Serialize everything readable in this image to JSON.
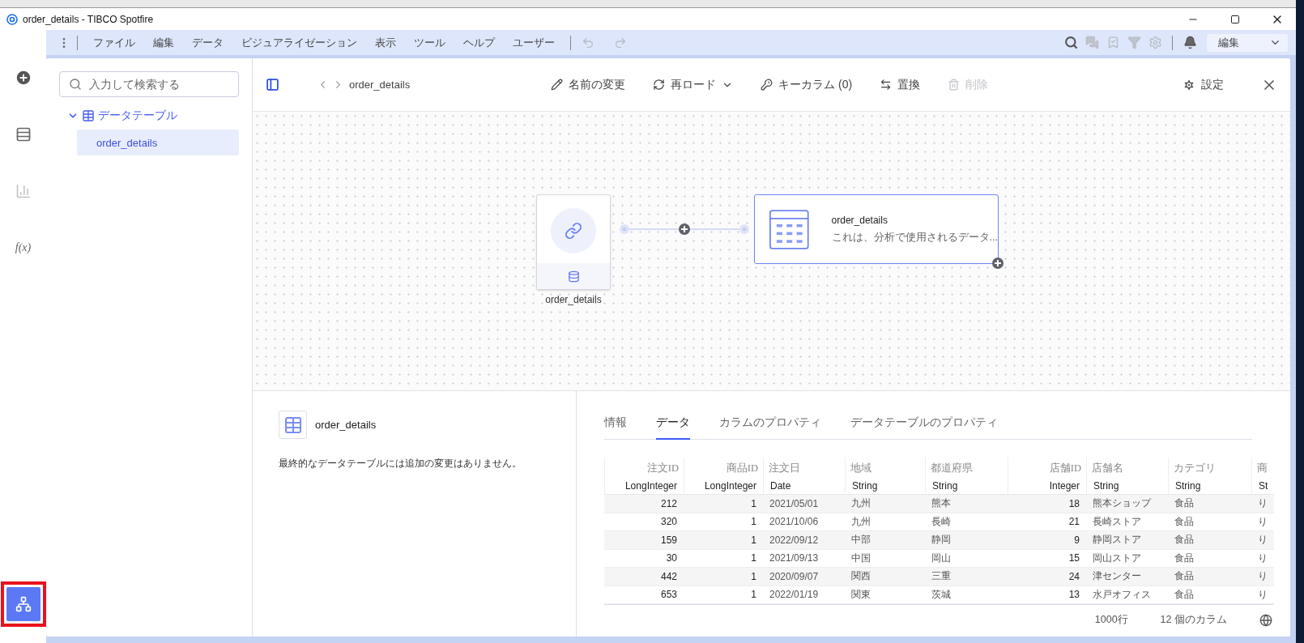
{
  "window": {
    "title": "order_details - TIBCO Spotfire"
  },
  "menu": [
    "ファイル",
    "編集",
    "データ",
    "ビジュアライゼーション",
    "表示",
    "ツール",
    "ヘルプ",
    "ユーザー"
  ],
  "mode_dropdown": {
    "value": "編集"
  },
  "rail": [
    {
      "kind": "add",
      "selected": false
    },
    {
      "kind": "table",
      "selected": false
    },
    {
      "kind": "chart",
      "selected": false
    },
    {
      "kind": "function",
      "label": "f(x)",
      "selected": false
    },
    {
      "kind": "flow",
      "selected": true
    }
  ],
  "search": {
    "placeholder": "入力して検索する"
  },
  "tree": [
    {
      "label": "データテーブル",
      "expanded": true,
      "children": [
        {
          "label": "order_details",
          "selected": true
        }
      ]
    }
  ],
  "toolbar": {
    "breadcrumb": "order_details",
    "actions": [
      {
        "kind": "rename",
        "label": "名前の変更",
        "disabled": false
      },
      {
        "kind": "reload",
        "label": "再ロード",
        "disabled": false
      },
      {
        "kind": "key",
        "label": "キーカラム (0)",
        "disabled": false
      },
      {
        "kind": "replace",
        "label": "置換",
        "disabled": false
      },
      {
        "kind": "delete",
        "label": "削除",
        "disabled": true
      }
    ],
    "settings": "設定"
  },
  "canvas": {
    "source": {
      "label": "order_details"
    },
    "table_node": {
      "title": "order_details",
      "description": "これは、分析で使用されるデータ..."
    }
  },
  "summary": {
    "title": "order_details",
    "message": "最終的なデータテーブルには追加の変更はありません。"
  },
  "tabs": [
    {
      "label": "情報",
      "selected": false
    },
    {
      "label": "データ",
      "selected": true
    },
    {
      "label": "カラムのプロパティ",
      "selected": false
    },
    {
      "label": "データテーブルのプロパティ",
      "selected": false
    }
  ],
  "table": {
    "columns": [
      {
        "name": "注文ID",
        "type": "LongInteger",
        "kind": "numeric"
      },
      {
        "name": "商品ID",
        "type": "LongInteger",
        "kind": "numeric"
      },
      {
        "name": "注文日",
        "type": "Date",
        "kind": "text"
      },
      {
        "name": "地域",
        "type": "String",
        "kind": "text"
      },
      {
        "name": "都道府県",
        "type": "String",
        "kind": "text"
      },
      {
        "name": "店舗ID",
        "type": "Integer",
        "kind": "numeric"
      },
      {
        "name": "店舗名",
        "type": "String",
        "kind": "text"
      },
      {
        "name": "カテゴリ",
        "type": "String",
        "kind": "text"
      },
      {
        "name": "商",
        "type": "St",
        "kind": "text"
      }
    ],
    "rows": [
      [
        "212",
        "1",
        "2021/05/01",
        "九州",
        "熊本",
        "18",
        "熊本ショップ",
        "食品",
        "り"
      ],
      [
        "320",
        "1",
        "2021/10/06",
        "九州",
        "長崎",
        "21",
        "長崎ストア",
        "食品",
        "り"
      ],
      [
        "159",
        "1",
        "2022/09/12",
        "中部",
        "静岡",
        "9",
        "静岡ストア",
        "食品",
        "り"
      ],
      [
        "30",
        "1",
        "2021/09/13",
        "中国",
        "岡山",
        "15",
        "岡山ストア",
        "食品",
        "り"
      ],
      [
        "442",
        "1",
        "2020/09/07",
        "関西",
        "三重",
        "24",
        "津センター",
        "食品",
        "り"
      ],
      [
        "653",
        "1",
        "2022/01/19",
        "関東",
        "茨城",
        "13",
        "水戸オフィス",
        "食品",
        "り"
      ]
    ]
  },
  "status": {
    "rows": "1000行",
    "columns": "12 個のカラム"
  }
}
